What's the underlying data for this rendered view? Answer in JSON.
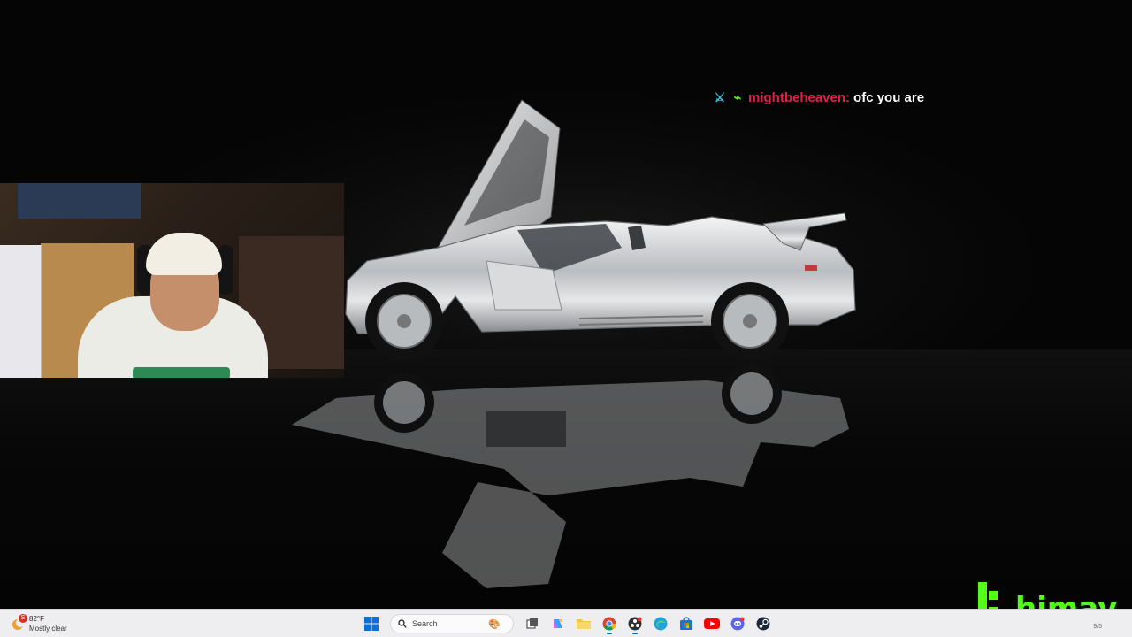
{
  "chat": {
    "username": "mightbeheaven:",
    "message": "ofc you are",
    "username_color": "#e0204a"
  },
  "logo": {
    "text": "himay",
    "color": "#53fc18"
  },
  "taskbar": {
    "weather": {
      "badge": "S",
      "temperature": "82°F",
      "condition": "Mostly clear"
    },
    "search": {
      "placeholder": "Search"
    },
    "corner_text": "9/5",
    "apps": [
      "start-icon",
      "search-icon",
      "task-view-icon",
      "copilot-icon",
      "file-explorer-icon",
      "chrome-icon",
      "obs-icon",
      "edge-icon",
      "microsoft-store-icon",
      "youtube-icon",
      "discord-icon",
      "steam-icon"
    ]
  }
}
